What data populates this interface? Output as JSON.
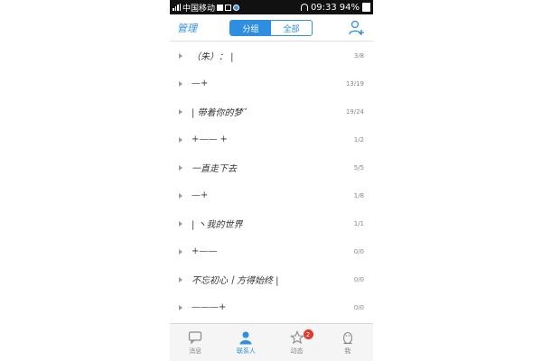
{
  "status_bar": {
    "carrier": "中国移动",
    "time": "09:33",
    "battery": "94%"
  },
  "nav": {
    "left_label": "管理",
    "segments": [
      {
        "label": "分组",
        "active": true
      },
      {
        "label": "全部",
        "active": false
      }
    ],
    "right_icon": "add-user-icon"
  },
  "groups": [
    {
      "name": "（朱）：    |",
      "count": "3/8"
    },
    {
      "name": "—+",
      "count": "13/19"
    },
    {
      "name": "|  带着你的梦゛",
      "count": "19/24"
    },
    {
      "name": "+——    +",
      "count": "1/2"
    },
    {
      "name": "一直走下去",
      "count": "5/5"
    },
    {
      "name": "—+",
      "count": "1/8"
    },
    {
      "name": "|    丶我的世界",
      "count": "1/1"
    },
    {
      "name": "+——",
      "count": "0/0"
    },
    {
      "name": "不忘初心丨方得始终 |",
      "count": "0/0"
    },
    {
      "name": "———+",
      "count": "0/0"
    }
  ],
  "tabs": [
    {
      "label": "消息",
      "icon": "message-icon",
      "active": false
    },
    {
      "label": "联系人",
      "icon": "contacts-icon",
      "active": true
    },
    {
      "label": "动态",
      "icon": "star-icon",
      "active": false,
      "badge": "2"
    },
    {
      "label": "我",
      "icon": "penguin-icon",
      "active": false
    }
  ],
  "colors": {
    "accent": "#2e8ee0",
    "badge": "#e43a2e",
    "status_bar": "#111111"
  }
}
